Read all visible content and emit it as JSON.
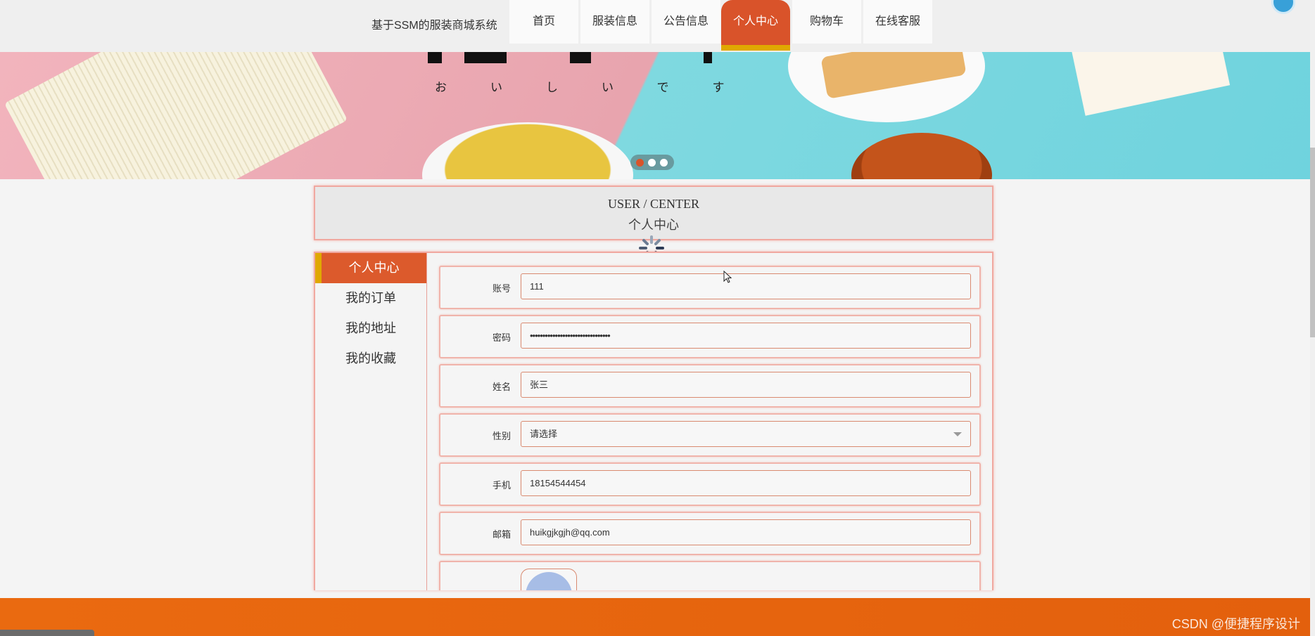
{
  "site": {
    "title": "基于SSM的服装商城系统"
  },
  "nav": {
    "items": [
      {
        "label": "首页"
      },
      {
        "label": "服装信息"
      },
      {
        "label": "公告信息"
      },
      {
        "label": "个人中心"
      },
      {
        "label": "购物车"
      },
      {
        "label": "在线客服"
      }
    ],
    "active_index": 3
  },
  "banner": {
    "kana": "おいしいです",
    "carousel_dots": 3,
    "active_dot": 0
  },
  "center": {
    "title_en": "USER / CENTER",
    "title_cn": "个人中心"
  },
  "sidebar": {
    "items": [
      {
        "label": "个人中心"
      },
      {
        "label": "我的订单"
      },
      {
        "label": "我的地址"
      },
      {
        "label": "我的收藏"
      }
    ],
    "active_index": 0
  },
  "form": {
    "account": {
      "label": "账号",
      "value": "111"
    },
    "password": {
      "label": "密码",
      "value": "••••••••••••••••••••••••••••••••"
    },
    "name": {
      "label": "姓名",
      "value": "张三"
    },
    "gender": {
      "label": "性别",
      "value": "请选择"
    },
    "phone": {
      "label": "手机",
      "value": "18154544454"
    },
    "email": {
      "label": "邮箱",
      "value": "huikgjkgjh@qq.com"
    }
  },
  "footer": {
    "watermark": "CSDN @便捷程序设计"
  },
  "colors": {
    "accent": "#d9532a",
    "accent_bar": "#e0a800",
    "footer": "#e8650f",
    "border": "#f0a8a0"
  }
}
